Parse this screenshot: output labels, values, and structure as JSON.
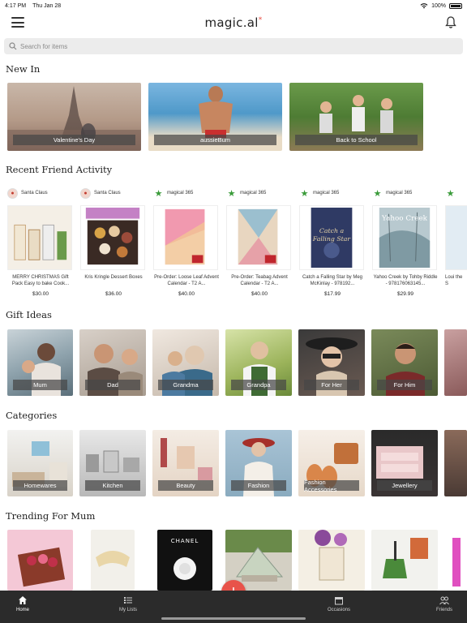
{
  "status": {
    "time": "4:17 PM",
    "date": "Thu Jan 28",
    "battery": "100%"
  },
  "app": {
    "logo": "magic.al",
    "logo_mark": "*"
  },
  "search": {
    "placeholder": "Search for items"
  },
  "sections": {
    "new_in": "New In",
    "recent": "Recent Friend Activity",
    "gift_ideas": "Gift Ideas",
    "categories": "Categories",
    "trending": "Trending For Mum"
  },
  "new_in": [
    {
      "label": "Valentine's Day"
    },
    {
      "label": "aussieBum"
    },
    {
      "label": "Back to School"
    }
  ],
  "friend_activity": [
    {
      "user": "Santa Claus",
      "name": "MERRY CHRISTMAS Gift Pack Easy to bake Cook...",
      "price": "$30.00"
    },
    {
      "user": "Santa Claus",
      "name": "Kris Kringle Dessert Boxes",
      "price": "$36.00"
    },
    {
      "user": "magical 365",
      "name": "Pre-Order: Loose Leaf Advent Calendar - T2 A...",
      "price": "$40.00"
    },
    {
      "user": "magical 365",
      "name": "Pre-Order: Teabag Advent Calendar - T2 A...",
      "price": "$40.00"
    },
    {
      "user": "magical 365",
      "name": "Catch a Falling Star by Meg McKinlay - 978192...",
      "price": "$17.99"
    },
    {
      "user": "magical 365",
      "name": "Yahoo Creek by Tohby Riddle - 978176063145...",
      "price": "$29.99"
    },
    {
      "user": "",
      "name": "Loui the S",
      "price": ""
    }
  ],
  "gift_ideas": [
    {
      "label": "Mum"
    },
    {
      "label": "Dad"
    },
    {
      "label": "Grandma"
    },
    {
      "label": "Grandpa"
    },
    {
      "label": "For Her"
    },
    {
      "label": "For Him"
    },
    {
      "label": ""
    }
  ],
  "categories": [
    {
      "label": "Homewares"
    },
    {
      "label": "Kitchen"
    },
    {
      "label": "Beauty"
    },
    {
      "label": "Fashion"
    },
    {
      "label": "Fashion Accessories"
    },
    {
      "label": "Jewellery"
    },
    {
      "label": ""
    }
  ],
  "trending_brand": "CHANEL",
  "tabs": [
    {
      "label": "Home",
      "icon": "home-icon"
    },
    {
      "label": "My Lists",
      "icon": "list-icon"
    },
    {
      "label": "Occasions",
      "icon": "calendar-icon"
    },
    {
      "label": "Friends",
      "icon": "friends-icon"
    }
  ],
  "fab": {
    "label": "+"
  },
  "colors": {
    "accent": "#e8534a",
    "tab_bar": "#2b2b2b",
    "star_green": "#3a9b3a"
  }
}
